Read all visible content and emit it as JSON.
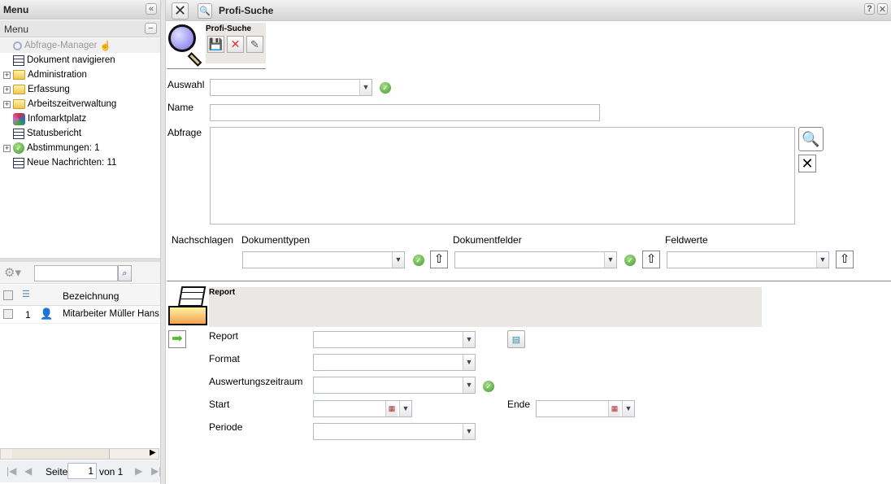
{
  "left": {
    "title": "Menu",
    "collapse_icon": "double-chevron-left",
    "section_title": "Menu",
    "tree": [
      {
        "label": "Abfrage-Manager",
        "icon": "magnifier",
        "expandable": false,
        "disabled": true
      },
      {
        "label": "Dokument navigieren",
        "icon": "document-nav",
        "expandable": false
      },
      {
        "label": "Administration",
        "icon": "folder",
        "expandable": true
      },
      {
        "label": "Erfassung",
        "icon": "folder",
        "expandable": true
      },
      {
        "label": "Arbeitszeitverwaltung",
        "icon": "folder",
        "expandable": true
      },
      {
        "label": "Infomarktplatz",
        "icon": "network",
        "expandable": false
      },
      {
        "label": "Statusbericht",
        "icon": "report",
        "expandable": false
      },
      {
        "label": "Abstimmungen: 1",
        "icon": "vote-check",
        "expandable": true
      },
      {
        "label": "Neue Nachrichten: 11",
        "icon": "report",
        "expandable": false
      }
    ],
    "grid": {
      "search_value": "",
      "header": "Bezeichnung",
      "rows": [
        {
          "num": "1",
          "label": "Mitarbeiter Müller Hans"
        }
      ]
    },
    "pager": {
      "page_label": "Seite",
      "page": "1",
      "of_label": "von 1"
    }
  },
  "main": {
    "title": "Profi-Suche",
    "toolbar_title": "Profi-Suche",
    "fields": {
      "auswahl": "Auswahl",
      "name": "Name",
      "abfrage": "Abfrage",
      "nachschlagen": "Nachschlagen",
      "dokumenttypen": "Dokumenttypen",
      "dokumentfelder": "Dokumentfelder",
      "feldwerte": "Feldwerte"
    },
    "values": {
      "auswahl": "",
      "name": "",
      "abfrage": "",
      "dokumenttypen": "",
      "dokumentfelder": "",
      "feldwerte": ""
    },
    "report": {
      "title": "Report",
      "labels": {
        "report": "Report",
        "format": "Format",
        "zeitraum": "Auswertungszeitraum",
        "start": "Start",
        "ende": "Ende",
        "periode": "Periode"
      },
      "values": {
        "report": "",
        "format": "",
        "zeitraum": "",
        "start": "",
        "ende": "",
        "periode": ""
      }
    }
  }
}
